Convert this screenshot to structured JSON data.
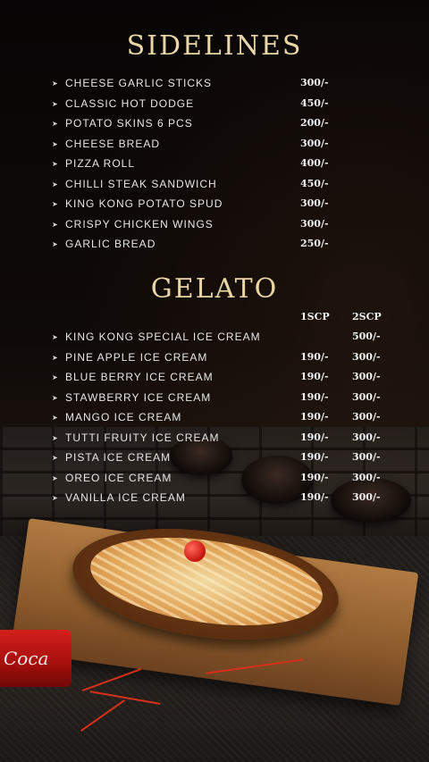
{
  "sidelines": {
    "title": "SIDELINES",
    "items": [
      {
        "name": "CHEESE GARLIC STICKS",
        "price": "300/-"
      },
      {
        "name": "CLASSIC HOT DODGE",
        "price": "450/-"
      },
      {
        "name": "POTATO SKINS 6 PCS",
        "price": "200/-"
      },
      {
        "name": "CHEESE BREAD",
        "price": "300/-"
      },
      {
        "name": "PIZZA ROLL",
        "price": "400/-"
      },
      {
        "name": "CHILLI STEAK SANDWICH",
        "price": "450/-"
      },
      {
        "name": "KING KONG POTATO SPUD",
        "price": "300/-"
      },
      {
        "name": "CRISPY CHICKEN WINGS",
        "price": "300/-"
      },
      {
        "name": "GARLIC BREAD",
        "price": "250/-"
      }
    ]
  },
  "gelato": {
    "title": "GELATO",
    "col1": "1SCP",
    "col2": "2SCP",
    "items": [
      {
        "name": "KING KONG SPECIAL ICE CREAM",
        "p1": "",
        "p2": "500/-"
      },
      {
        "name": "PINE APPLE ICE CREAM",
        "p1": "190/-",
        "p2": "300/-"
      },
      {
        "name": "BLUE BERRY ICE CREAM",
        "p1": "190/-",
        "p2": "300/-"
      },
      {
        "name": "STAWBERRY ICE CREAM",
        "p1": "190/-",
        "p2": "300/-"
      },
      {
        "name": "MANGO ICE CREAM",
        "p1": "190/-",
        "p2": "300/-"
      },
      {
        "name": "TUTTI FRUITY ICE CREAM",
        "p1": "190/-",
        "p2": "300/-"
      },
      {
        "name": "PISTA ICE CREAM",
        "p1": "190/-",
        "p2": "300/-"
      },
      {
        "name": "OREO ICE CREAM",
        "p1": "190/-",
        "p2": "300/-"
      },
      {
        "name": "VANILLA ICE CREAM",
        "p1": "190/-",
        "p2": "300/-"
      }
    ]
  },
  "bullet_glyph": "➤",
  "can_logo": "Coca",
  "colors": {
    "title_gold": "#e8d6a6",
    "text": "#e6e6e6",
    "background": "#0a0706"
  }
}
